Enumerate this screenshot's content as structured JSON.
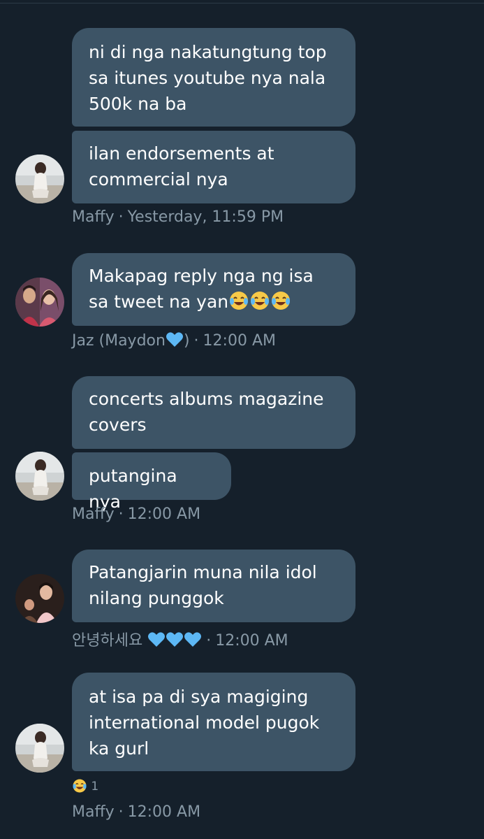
{
  "messages": [
    {
      "sender": "Maffy",
      "time": "Yesterday, 11:59 PM",
      "bubbles": [
        [
          "ni di nga nakatungtung top",
          "sa itunes youtube nya nala",
          "500k na ba"
        ],
        [
          "ilan endorsements at",
          "commercial nya"
        ]
      ]
    },
    {
      "sender": "Jaz (Maydon",
      "sender_suffix": ")",
      "time": "12:00 AM",
      "bubbles": [
        [
          "Makapag reply nga ng isa",
          "sa tweet na yan"
        ]
      ],
      "emoji": [
        "face-with-tears-of-joy",
        "face-with-tears-of-joy",
        "face-with-tears-of-joy"
      ]
    },
    {
      "sender": "Maffy",
      "time": "12:00 AM",
      "bubbles": [
        [
          "concerts albums magazine",
          "covers"
        ],
        [
          "putangina nya"
        ]
      ]
    },
    {
      "sender": "안녕하세요",
      "time": "12:00 AM",
      "bubbles": [
        [
          "Patangjarin muna nila idol",
          "nilang punggok"
        ]
      ]
    },
    {
      "sender": "Maffy",
      "time": "12:00 AM",
      "bubbles": [
        [
          "at isa pa di sya magiging",
          "international model pugok",
          "ka gurl"
        ]
      ],
      "reaction": {
        "emoji": "face-with-tears-of-joy",
        "count": "1"
      }
    }
  ],
  "separator": "·",
  "colors": {
    "background": "#15202b",
    "bubble": "#3d5466",
    "meta_text": "#8899a6",
    "heart": "#5db8f5"
  }
}
